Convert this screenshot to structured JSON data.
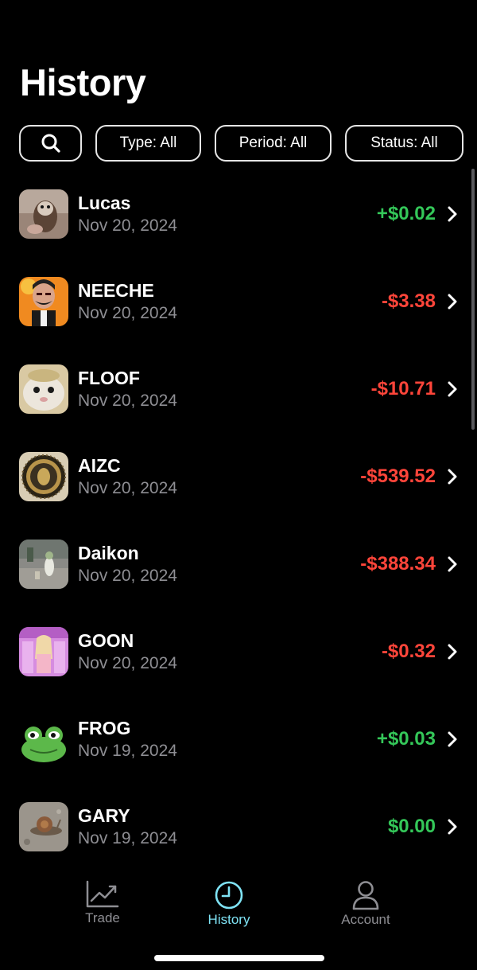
{
  "header": {
    "title": "History"
  },
  "filters": {
    "search_icon": "search-icon",
    "type_label": "Type: All",
    "period_label": "Period: All",
    "status_label": "Status: All"
  },
  "colors": {
    "positive": "#34c759",
    "negative": "#ff453a",
    "accent": "#7fe3f5",
    "muted": "#8e8e93"
  },
  "items": [
    {
      "name": "Lucas",
      "date": "Nov 20, 2024",
      "amount": "+$0.02",
      "sign": "pos",
      "image": "ferret-avatar"
    },
    {
      "name": "NEECHE",
      "date": "Nov 20, 2024",
      "amount": "-$3.38",
      "sign": "neg",
      "image": "mustache-man-avatar"
    },
    {
      "name": "FLOOF",
      "date": "Nov 20, 2024",
      "amount": "-$10.71",
      "sign": "neg",
      "image": "fluffy-animal-avatar"
    },
    {
      "name": "AIZC",
      "date": "Nov 20, 2024",
      "amount": "-$539.52",
      "sign": "neg",
      "image": "gold-coin-avatar"
    },
    {
      "name": "Daikon",
      "date": "Nov 20, 2024",
      "amount": "-$388.34",
      "sign": "neg",
      "image": "street-scene-avatar"
    },
    {
      "name": "GOON",
      "date": "Nov 20, 2024",
      "amount": "-$0.32",
      "sign": "neg",
      "image": "pink-poster-avatar"
    },
    {
      "name": "FROG",
      "date": "Nov 19, 2024",
      "amount": "+$0.03",
      "sign": "pos",
      "image": "frog-avatar"
    },
    {
      "name": "GARY",
      "date": "Nov 19, 2024",
      "amount": "$0.00",
      "sign": "pos",
      "image": "snail-avatar"
    }
  ],
  "tabbar": {
    "trade": {
      "label": "Trade",
      "icon": "chart-line-icon"
    },
    "history": {
      "label": "History",
      "icon": "clock-icon",
      "active": true
    },
    "account": {
      "label": "Account",
      "icon": "person-icon"
    }
  }
}
